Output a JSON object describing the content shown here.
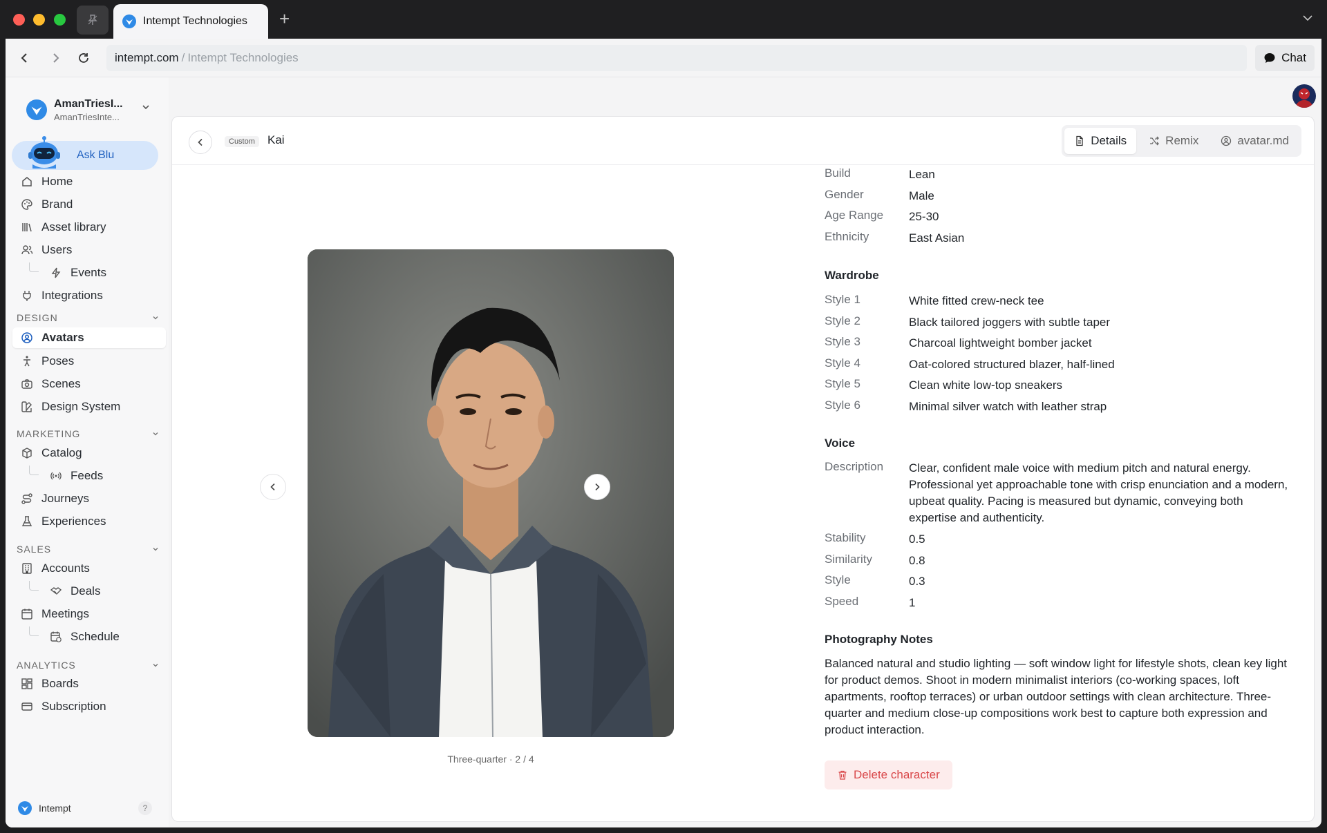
{
  "browser": {
    "tab_title": "Intempt Technologies",
    "url_domain": "intempt.com",
    "url_separator": "/",
    "url_page": "Intempt Technologies",
    "chat_label": "Chat"
  },
  "workspace": {
    "name": "AmanTriesI...",
    "sub": "AmanTriesInte..."
  },
  "ask_blu": "Ask Blu",
  "sidebar": {
    "items": [
      {
        "label": "Home"
      },
      {
        "label": "Brand"
      },
      {
        "label": "Asset library"
      },
      {
        "label": "Users"
      },
      {
        "label": "Events"
      },
      {
        "label": "Integrations"
      }
    ],
    "sections": [
      {
        "title": "DESIGN",
        "items": [
          {
            "label": "Avatars"
          },
          {
            "label": "Poses"
          },
          {
            "label": "Scenes"
          },
          {
            "label": "Design System"
          }
        ]
      },
      {
        "title": "MARKETING",
        "items": [
          {
            "label": "Catalog"
          },
          {
            "label": "Feeds"
          },
          {
            "label": "Journeys"
          },
          {
            "label": "Experiences"
          }
        ]
      },
      {
        "title": "SALES",
        "items": [
          {
            "label": "Accounts"
          },
          {
            "label": "Deals"
          },
          {
            "label": "Meetings"
          },
          {
            "label": "Schedule"
          }
        ]
      },
      {
        "title": "ANALYTICS",
        "items": [
          {
            "label": "Boards"
          },
          {
            "label": "Subscription"
          }
        ]
      }
    ],
    "footer_label": "Intempt",
    "help": "?"
  },
  "header": {
    "badge": "Custom",
    "title": "Kai",
    "tabs": [
      {
        "label": "Details"
      },
      {
        "label": "Remix"
      },
      {
        "label": "avatar.md"
      }
    ]
  },
  "gallery": {
    "caption": "Three-quarter · 2 / 4"
  },
  "details": {
    "basics": [
      {
        "k": "Build",
        "v": "Lean"
      },
      {
        "k": "Gender",
        "v": "Male"
      },
      {
        "k": "Age Range",
        "v": "25-30"
      },
      {
        "k": "Ethnicity",
        "v": "East Asian"
      }
    ],
    "wardrobe_title": "Wardrobe",
    "wardrobe": [
      {
        "k": "Style 1",
        "v": "White fitted crew-neck tee"
      },
      {
        "k": "Style 2",
        "v": "Black tailored joggers with subtle taper"
      },
      {
        "k": "Style 3",
        "v": "Charcoal lightweight bomber jacket"
      },
      {
        "k": "Style 4",
        "v": "Oat-colored structured blazer, half-lined"
      },
      {
        "k": "Style 5",
        "v": "Clean white low-top sneakers"
      },
      {
        "k": "Style 6",
        "v": "Minimal silver watch with leather strap"
      }
    ],
    "voice_title": "Voice",
    "voice": [
      {
        "k": "Description",
        "v": "Clear, confident male voice with medium pitch and natural energy. Professional yet approachable tone with crisp enunciation and a modern, upbeat quality. Pacing is measured but dynamic, conveying both expertise and authenticity."
      },
      {
        "k": "Stability",
        "v": "0.5"
      },
      {
        "k": "Similarity",
        "v": "0.8"
      },
      {
        "k": "Style",
        "v": "0.3"
      },
      {
        "k": "Speed",
        "v": "1"
      }
    ],
    "photo_title": "Photography Notes",
    "photo_notes": "Balanced natural and studio lighting — soft window light for lifestyle shots, clean key light for product demos. Shoot in modern minimalist interiors (co-working spaces, loft apartments, rooftop terraces) or urban outdoor settings with clean architecture. Three-quarter and medium close-up compositions work best to capture both expression and product interaction.",
    "delete_label": "Delete character"
  },
  "colors": {
    "accent": "#1e5fbf",
    "danger": "#d9484a",
    "danger_bg": "#fdecec"
  }
}
